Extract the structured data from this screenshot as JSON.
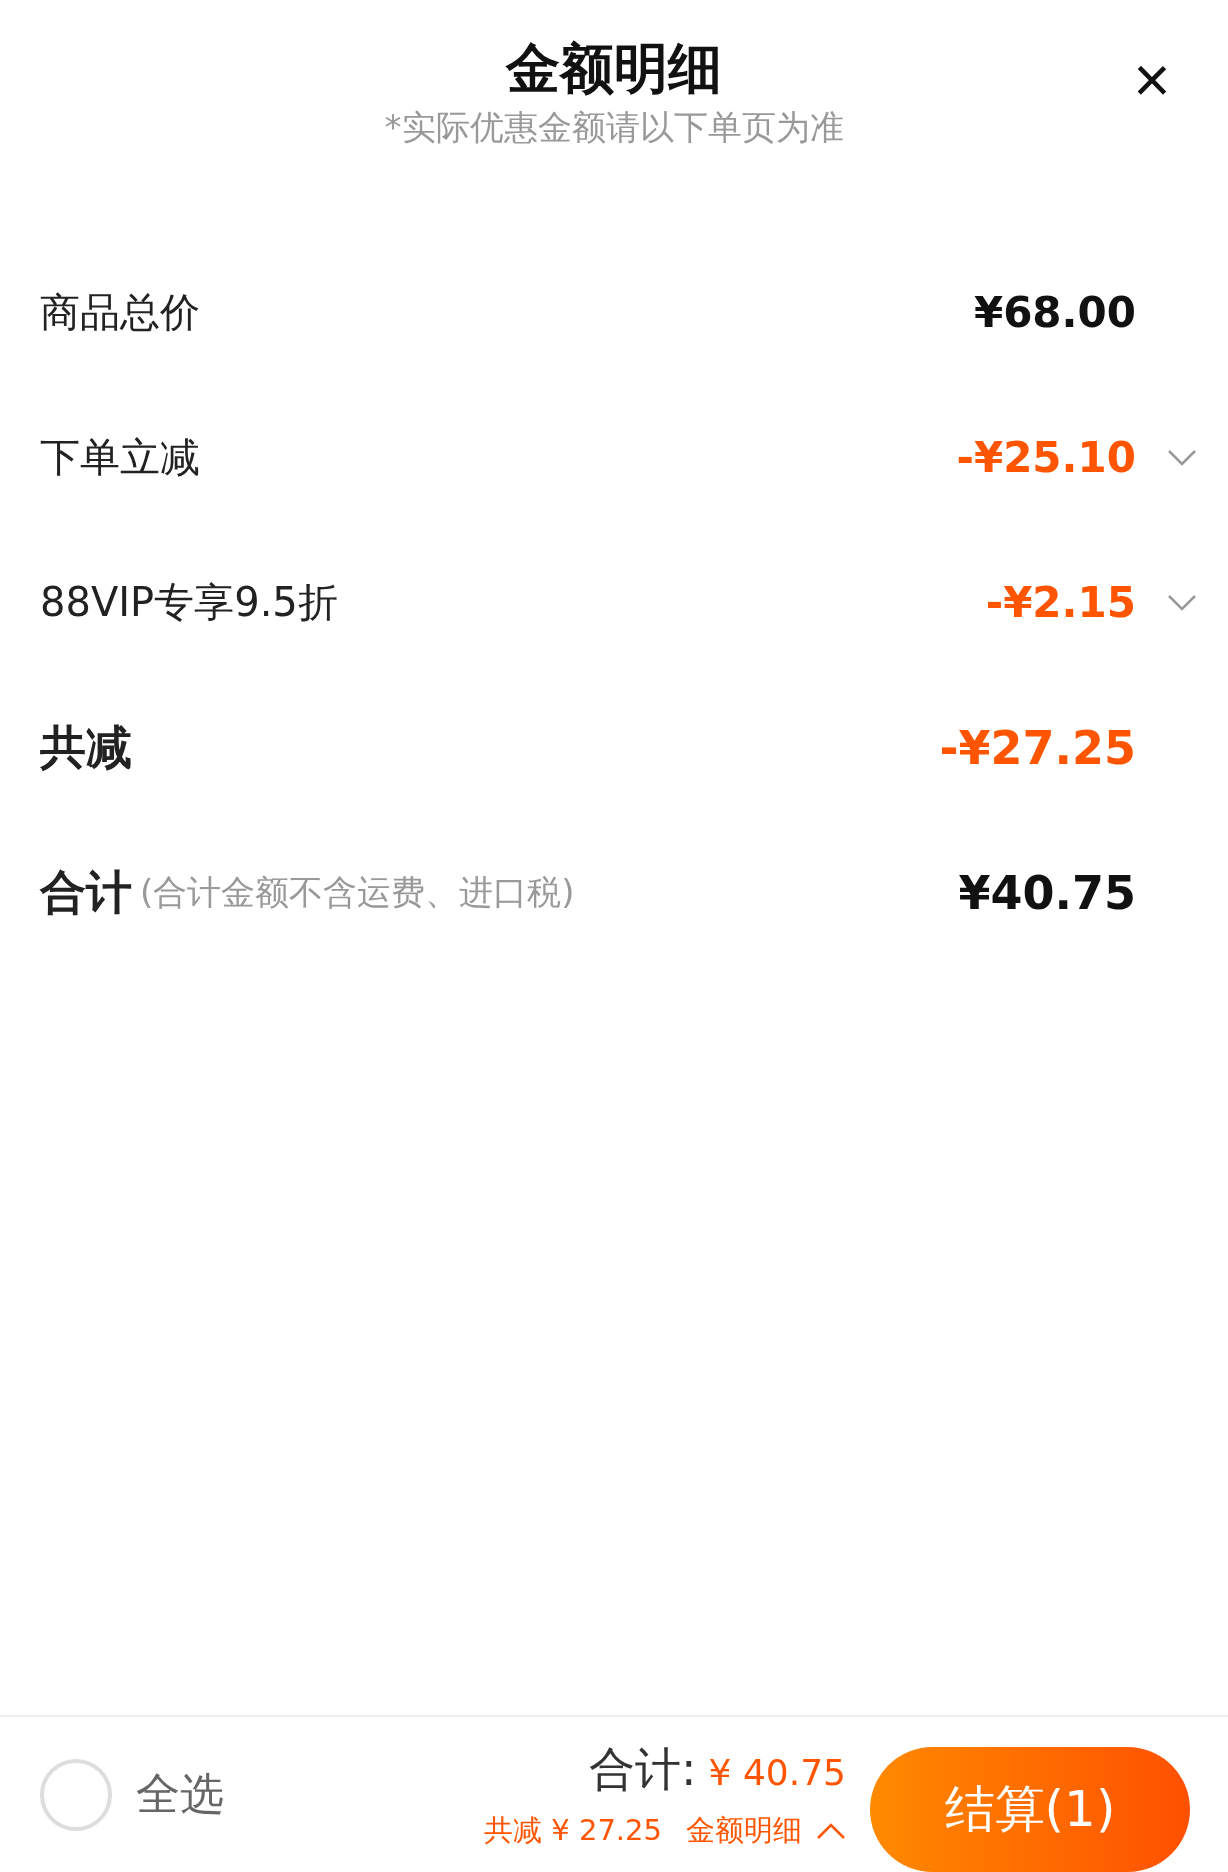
{
  "header": {
    "title": "金额明细",
    "subtitle": "*实际优惠金额请以下单页为准",
    "close": "×"
  },
  "rows": [
    {
      "kind": "normal",
      "label": "商品总价",
      "amount": "¥68.00",
      "discount": false,
      "expandable": false
    },
    {
      "kind": "normal",
      "label": "下单立减",
      "amount": "-¥25.10",
      "discount": true,
      "expandable": true
    },
    {
      "kind": "normal",
      "label": "88VIP专享9.5折",
      "amount": "-¥2.15",
      "discount": true,
      "expandable": true
    },
    {
      "kind": "bold",
      "label": "共减",
      "amount": "-¥27.25",
      "discount": true,
      "expandable": false
    },
    {
      "kind": "bold",
      "label": "合计",
      "note": "(合计金额不含运费、进口税)",
      "amount": "¥40.75",
      "discount": false,
      "expandable": false
    }
  ],
  "footer": {
    "select_all": {
      "label": "全选",
      "checked": false
    },
    "total_label": "合计:",
    "total_amount": "¥ 40.75",
    "saved": "共减 ¥ 27.25",
    "details_link": "金额明细",
    "details_expanded": true,
    "checkout": "结算(1)"
  }
}
